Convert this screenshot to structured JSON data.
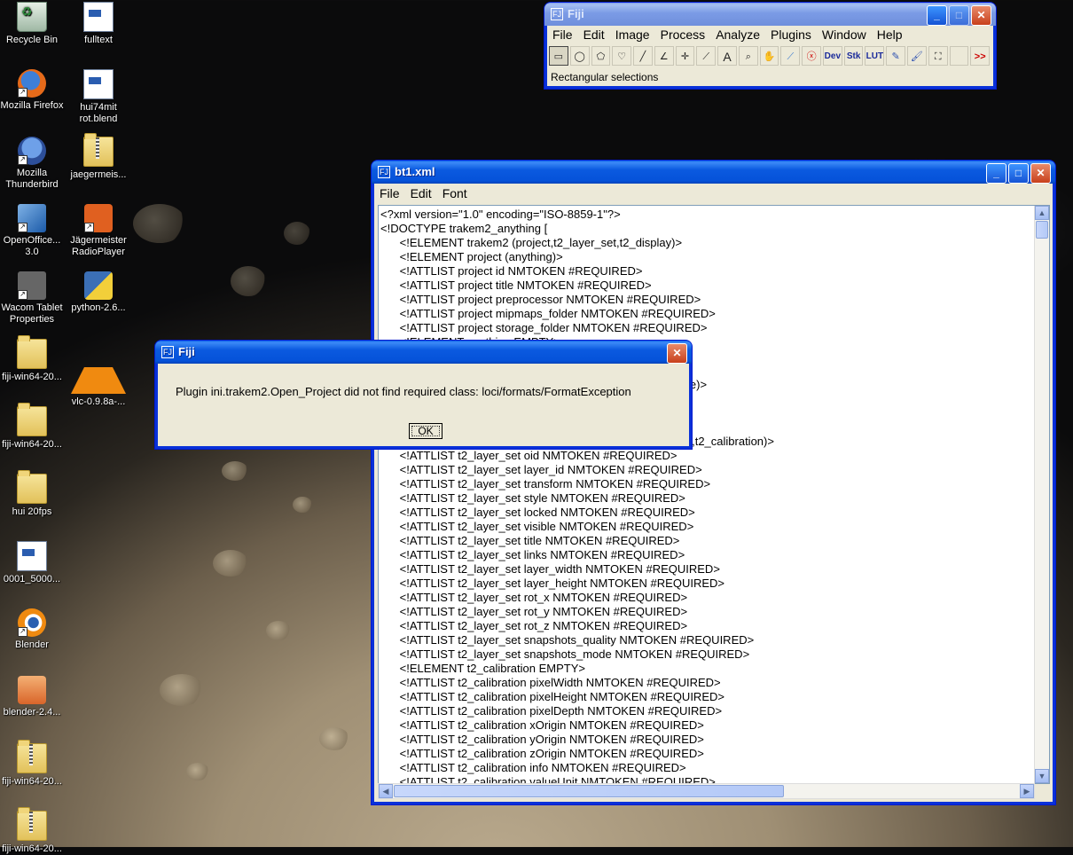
{
  "desktop": {
    "icons": [
      {
        "label": "Recycle Bin",
        "icon": "recycle-bin-icon"
      },
      {
        "label": "fulltext",
        "icon": "document-icon"
      },
      {
        "label": "Mozilla Firefox",
        "icon": "firefox-icon"
      },
      {
        "label": "hui74mit rot.blend",
        "icon": "document-icon"
      },
      {
        "label": "Mozilla Thunderbird",
        "icon": "thunderbird-icon"
      },
      {
        "label": "jaegermeis...",
        "icon": "zip-folder-icon"
      },
      {
        "label": "OpenOffice... 3.0",
        "icon": "openoffice-icon"
      },
      {
        "label": "Jägermeister RadioPlayer",
        "icon": "jagermeister-icon"
      },
      {
        "label": "Wacom Tablet Properties",
        "icon": "wacom-icon"
      },
      {
        "label": "python-2.6...",
        "icon": "python-installer-icon"
      },
      {
        "label": "fiji-win64-20...",
        "icon": "folder-icon"
      },
      {
        "label": "vlc-0.9.8a-...",
        "icon": "vlc-icon"
      },
      {
        "label": "fiji-win64-20...",
        "icon": "folder-icon"
      },
      {
        "label": "hui 20fps",
        "icon": "folder-icon"
      },
      {
        "label": "0001_5000...",
        "icon": "document-icon"
      },
      {
        "label": "Blender",
        "icon": "blender-icon"
      },
      {
        "label": "blender-2.4...",
        "icon": "blender-installer-icon"
      },
      {
        "label": "fiji-win64-20...",
        "icon": "zip-folder-icon"
      },
      {
        "label": "fiji-win64-20...",
        "icon": "zip-folder-icon"
      }
    ]
  },
  "fiji_main": {
    "title": "Fiji",
    "menu": [
      "File",
      "Edit",
      "Image",
      "Process",
      "Analyze",
      "Plugins",
      "Window",
      "Help"
    ],
    "tools": [
      "rectangle-tool-icon",
      "oval-tool-icon",
      "polygon-tool-icon",
      "freehand-tool-icon",
      "line-tool-icon",
      "angle-tool-icon",
      "point-tool-icon",
      "wand-tool-icon",
      "text-tool-icon",
      "magnifier-tool-icon",
      "hand-tool-icon",
      "dropper-tool-icon",
      "close-circle-icon",
      "Dev",
      "Stk",
      "LUT",
      "pencil-tool-icon",
      "brush-tool-icon",
      "flood-fill-tool-icon",
      "blank-tool",
      ">>"
    ],
    "status": "Rectangular selections"
  },
  "text_window": {
    "title": "bt1.xml",
    "menu": [
      "File",
      "Edit",
      "Font"
    ],
    "lines": [
      "<?xml version=\"1.0\" encoding=\"ISO-8859-1\"?>",
      "<!DOCTYPE trakem2_anything [",
      "\t<!ELEMENT trakem2 (project,t2_layer_set,t2_display)>",
      "\t<!ELEMENT project (anything)>",
      "\t<!ATTLIST project id NMTOKEN #REQUIRED>",
      "\t<!ATTLIST project title NMTOKEN #REQUIRED>",
      "\t<!ATTLIST project preprocessor NMTOKEN #REQUIRED>",
      "\t<!ATTLIST project mipmaps_folder NMTOKEN #REQUIRED>",
      "\t<!ATTLIST project storage_folder NMTOKEN #REQUIRED>",
      "\t<!ELEMENT anything EMPTY>",
      "",
      "\t                                                                      UIRED>",
      "\t                                                                      _set,t2_profile)>",
      "",
      "\t                                                                      UIRED>",
      "",
      "\t                                                                      ll,t2_area_list,t2_calibration)>",
      "\t<!ATTLIST t2_layer_set oid NMTOKEN #REQUIRED>",
      "\t<!ATTLIST t2_layer_set layer_id NMTOKEN #REQUIRED>",
      "\t<!ATTLIST t2_layer_set transform NMTOKEN #REQUIRED>",
      "\t<!ATTLIST t2_layer_set style NMTOKEN #REQUIRED>",
      "\t<!ATTLIST t2_layer_set locked NMTOKEN #REQUIRED>",
      "\t<!ATTLIST t2_layer_set visible NMTOKEN #REQUIRED>",
      "\t<!ATTLIST t2_layer_set title NMTOKEN #REQUIRED>",
      "\t<!ATTLIST t2_layer_set links NMTOKEN #REQUIRED>",
      "\t<!ATTLIST t2_layer_set layer_width NMTOKEN #REQUIRED>",
      "\t<!ATTLIST t2_layer_set layer_height NMTOKEN #REQUIRED>",
      "\t<!ATTLIST t2_layer_set rot_x NMTOKEN #REQUIRED>",
      "\t<!ATTLIST t2_layer_set rot_y NMTOKEN #REQUIRED>",
      "\t<!ATTLIST t2_layer_set rot_z NMTOKEN #REQUIRED>",
      "\t<!ATTLIST t2_layer_set snapshots_quality NMTOKEN #REQUIRED>",
      "\t<!ATTLIST t2_layer_set snapshots_mode NMTOKEN #REQUIRED>",
      "\t<!ELEMENT t2_calibration EMPTY>",
      "\t<!ATTLIST t2_calibration pixelWidth NMTOKEN #REQUIRED>",
      "\t<!ATTLIST t2_calibration pixelHeight NMTOKEN #REQUIRED>",
      "\t<!ATTLIST t2_calibration pixelDepth NMTOKEN #REQUIRED>",
      "\t<!ATTLIST t2_calibration xOrigin NMTOKEN #REQUIRED>",
      "\t<!ATTLIST t2_calibration yOrigin NMTOKEN #REQUIRED>",
      "\t<!ATTLIST t2_calibration zOrigin NMTOKEN #REQUIRED>",
      "\t<!ATTLIST t2_calibration info NMTOKEN #REQUIRED>",
      "\t<!ATTLIST t2_calibration valueUnit NMTOKEN #REQUIRED>"
    ]
  },
  "dialog": {
    "title": "Fiji",
    "message": "Plugin ini.trakem2.Open_Project did not find required class: loci/formats/FormatException",
    "ok_label": "OK"
  },
  "glyphs": {
    "fiji_icon": "FJ",
    "minimize": "_",
    "maximize": "□",
    "close": "✕",
    "arrow_up": "▲",
    "arrow_down": "▼",
    "arrow_left": "◀",
    "arrow_right": "▶"
  }
}
